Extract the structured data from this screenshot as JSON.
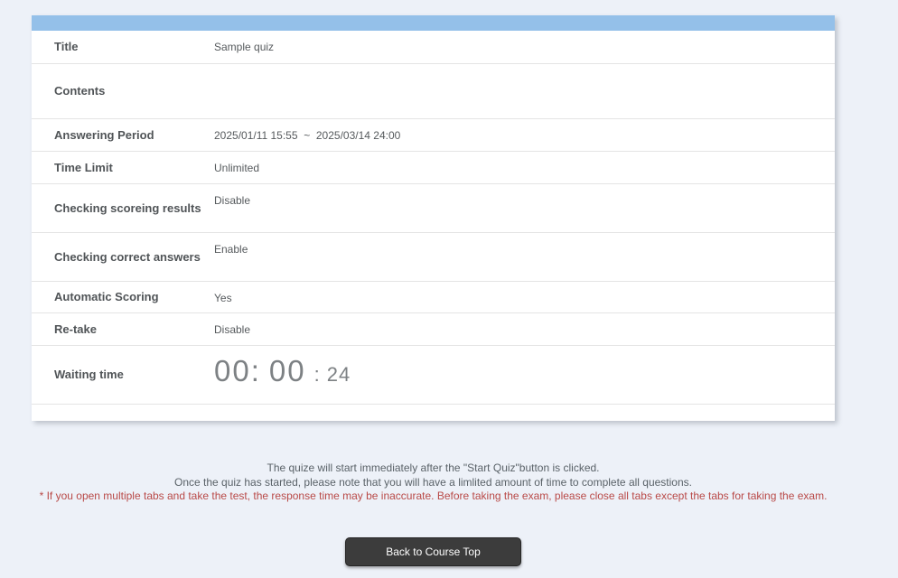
{
  "page": {
    "background_color": "#edf1f8"
  },
  "quiz_info": {
    "header_bar_color": "#94c0e9",
    "rows": [
      {
        "label": "Title",
        "value": "Sample quiz"
      },
      {
        "label": "Contents",
        "value": ""
      },
      {
        "label": "Answering Period",
        "value": "2025/01/11 15:55  ~  2025/03/14 24:00"
      },
      {
        "label": "Time Limit",
        "value": "Unlimited"
      },
      {
        "label": "Checking scoreing results",
        "value": "Disable"
      },
      {
        "label": "Checking correct answers",
        "value": "Enable"
      },
      {
        "label": "Automatic Scoring",
        "value": "Yes"
      },
      {
        "label": "Re-take",
        "value": "Disable"
      },
      {
        "label": "Waiting time",
        "value": "00:00:24"
      }
    ],
    "waiting_time": {
      "hours": "00",
      "minutes": "00",
      "seconds": "24",
      "separator": ":",
      "digit_color": "#7d8184"
    }
  },
  "notes": {
    "line1": "The quize will start immediately after the \"Start Quiz\"button is clicked.",
    "line2": "Once the quiz has started, please note that you will have a limlited amount of time to complete all questions.",
    "warning": "* If you open multiple tabs and take the test, the response time may be inaccurate. Before taking the exam, please close all tabs except the tabs for taking the exam.",
    "warning_color": "#b94a48"
  },
  "actions": {
    "back_button": "Back to Course Top"
  }
}
